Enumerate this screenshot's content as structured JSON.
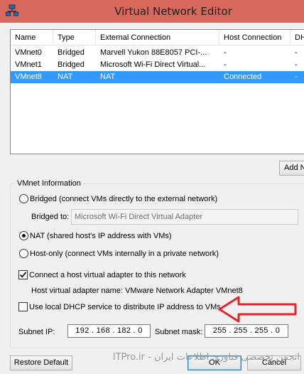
{
  "window": {
    "title": "Virtual Network Editor"
  },
  "table": {
    "columns": [
      "Name",
      "Type",
      "External Connection",
      "Host Connection",
      "DHCP"
    ],
    "rows": [
      [
        "VMnet0",
        "Bridged",
        "Marvell Yukon 88E8057 PCI-...",
        "-",
        "-"
      ],
      [
        "VMnet1",
        "Bridged",
        "Microsoft Wi-Fi Direct Virtual...",
        "-",
        "-"
      ],
      [
        "VMnet8",
        "NAT",
        "NAT",
        "Connected",
        "-"
      ]
    ],
    "selected_row": 2
  },
  "buttons": {
    "add_network": "Add N",
    "restore_default": "Restore Default",
    "ok": "OK",
    "cancel": "Cancel"
  },
  "vmnet_info": {
    "legend": "VMnet Information",
    "bridged_label": "Bridged (connect VMs directly to the external network)",
    "bridged_to_label": "Bridged to:",
    "bridged_to_value": "Microsoft Wi-Fi Direct Virtual Adapter",
    "nat_label": "NAT (shared host's IP address with VMs)",
    "host_only_label": "Host-only (connect VMs internally in a private network)",
    "selected_mode": "nat",
    "connect_host_adapter_label": "Connect a host virtual adapter to this network",
    "connect_host_adapter_checked": true,
    "host_adapter_name": "Host virtual adapter name: VMware Network Adapter VMnet8",
    "dhcp_label": "Use local DHCP service to distribute IP address to VMs",
    "dhcp_checked": false,
    "subnet_ip_label": "Subnet IP:",
    "subnet_ip_value": "192 . 168 . 182 . 0",
    "subnet_mask_label": "Subnet mask:",
    "subnet_mask_value": "255 . 255 . 255 . 0"
  },
  "watermark": {
    "text": "انجمن تخصصی فناوری اطلاعات ایران - ITPro.ir"
  },
  "colors": {
    "titlebar": "#d8685c",
    "selection": "#3399ff",
    "arrow": "#e3242b"
  }
}
